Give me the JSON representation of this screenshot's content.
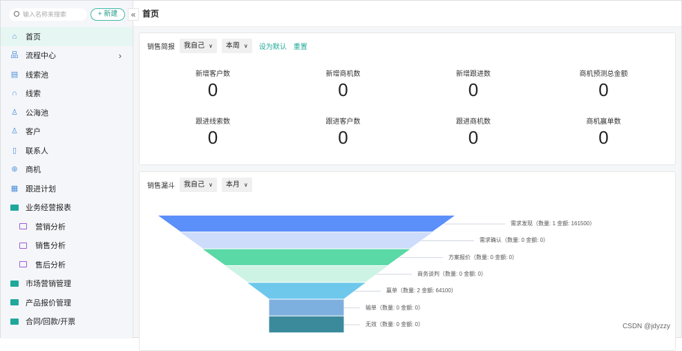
{
  "sidebar": {
    "search_placeholder": "输入名称来搜索",
    "new_label": "+ 新建",
    "collapse": "«",
    "items": [
      {
        "label": "首页",
        "icon": "home-icon",
        "type": "icon",
        "glyph": "⌂",
        "active": true
      },
      {
        "label": "流程中心",
        "icon": "flow-icon",
        "type": "icon",
        "glyph": "品",
        "arrow": "›"
      },
      {
        "label": "线索池",
        "icon": "lead-pool-icon",
        "type": "icon",
        "glyph": "▤"
      },
      {
        "label": "线索",
        "icon": "lead-icon",
        "type": "icon",
        "glyph": "∩"
      },
      {
        "label": "公海池",
        "icon": "public-pool-icon",
        "type": "icon",
        "glyph": "♙"
      },
      {
        "label": "客户",
        "icon": "customer-icon",
        "type": "icon",
        "glyph": "♙"
      },
      {
        "label": "联系人",
        "icon": "contact-icon",
        "type": "icon",
        "glyph": "▯"
      },
      {
        "label": "商机",
        "icon": "opportunity-icon",
        "type": "icon",
        "glyph": "⊛"
      },
      {
        "label": "跟进计划",
        "icon": "calendar-icon",
        "type": "icon",
        "glyph": "▦"
      },
      {
        "label": "业务经营报表",
        "icon": "folder-icon",
        "type": "folder"
      },
      {
        "label": "营销分析",
        "icon": "monitor-icon",
        "type": "sub"
      },
      {
        "label": "销售分析",
        "icon": "monitor-icon",
        "type": "sub"
      },
      {
        "label": "售后分析",
        "icon": "monitor-icon",
        "type": "sub"
      },
      {
        "label": "市场营销管理",
        "icon": "folder-icon",
        "type": "folder"
      },
      {
        "label": "产品报价管理",
        "icon": "folder-icon",
        "type": "folder"
      },
      {
        "label": "合同/回款/开票",
        "icon": "folder-icon",
        "type": "folder"
      }
    ]
  },
  "header": {
    "title": "首页"
  },
  "brief": {
    "title": "销售简报",
    "scope": "我自己",
    "period": "本周",
    "set_default": "设为默认",
    "reset": "重置",
    "stats": [
      {
        "label": "新增客户数",
        "value": "0"
      },
      {
        "label": "新增商机数",
        "value": "0"
      },
      {
        "label": "新增跟进数",
        "value": "0"
      },
      {
        "label": "商机预测总金额",
        "value": "0"
      },
      {
        "label": "跟进线索数",
        "value": "0"
      },
      {
        "label": "跟进客户数",
        "value": "0"
      },
      {
        "label": "跟进商机数",
        "value": "0"
      },
      {
        "label": "商机赢单数",
        "value": "0"
      }
    ]
  },
  "funnel": {
    "title": "销售漏斗",
    "scope": "我自己",
    "period": "本月",
    "chart_data": {
      "type": "funnel",
      "stages": [
        {
          "name": "需求发现",
          "count": 1,
          "amount": 161500,
          "label": "需求发现（数量: 1 金额: 161500）",
          "color": "#5b8ff9"
        },
        {
          "name": "需求确认",
          "count": 0,
          "amount": 0,
          "label": "需求确认（数量: 0 金额: 0）",
          "color": "#cddcfb"
        },
        {
          "name": "方案报价",
          "count": 0,
          "amount": 0,
          "label": "方案报价（数量: 0 金额: 0）",
          "color": "#5ad8a6"
        },
        {
          "name": "商务谈判",
          "count": 0,
          "amount": 0,
          "label": "商务谈判（数量: 0 金额: 0）",
          "color": "#cdf3e4"
        },
        {
          "name": "赢单",
          "count": 2,
          "amount": 64100,
          "label": "赢单（数量: 2 金额: 64100）",
          "color": "#6dc8ec"
        },
        {
          "name": "输单",
          "count": 0,
          "amount": 0,
          "label": "输单（数量: 0 金额: 0）",
          "color": "#7eb0df"
        },
        {
          "name": "无效",
          "count": 0,
          "amount": 0,
          "label": "无效（数量: 0 金额: 0）",
          "color": "#3b8a9c"
        }
      ]
    }
  },
  "watermark": "CSDN @jdyzzy"
}
